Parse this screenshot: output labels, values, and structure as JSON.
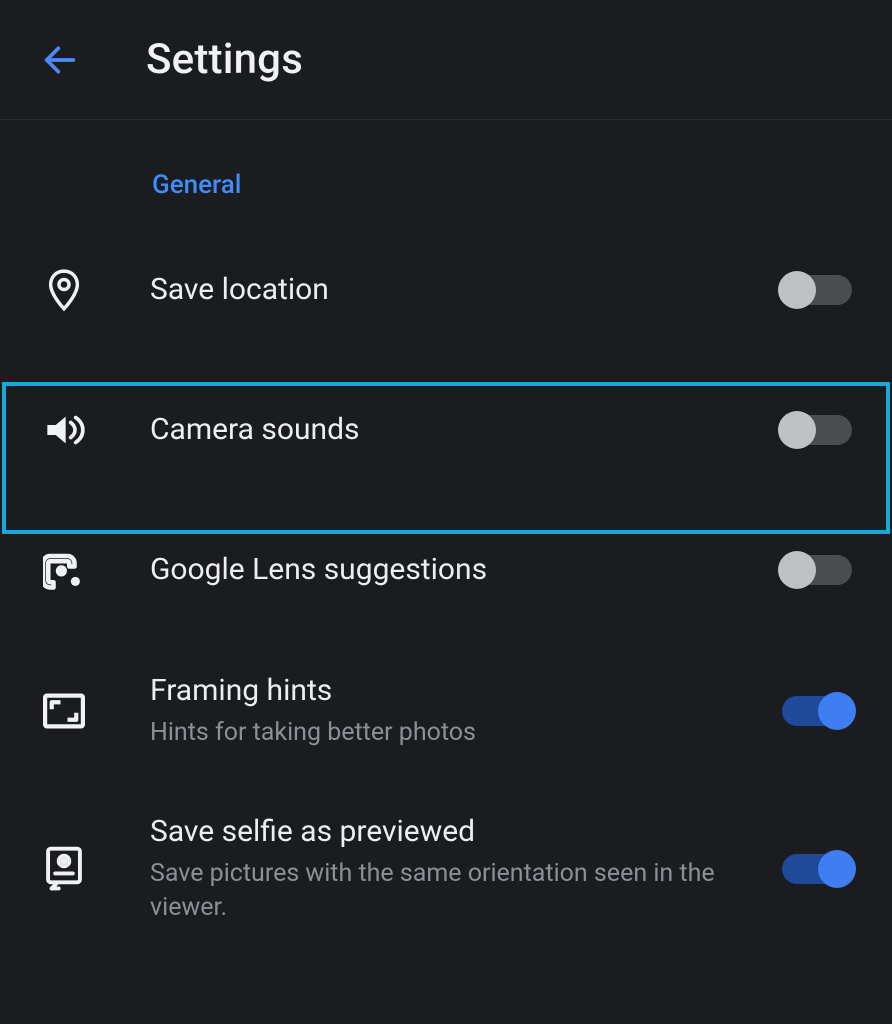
{
  "header": {
    "title": "Settings"
  },
  "section": {
    "label": "General"
  },
  "items": [
    {
      "key": "save-location",
      "title": "Save location",
      "subtitle": "",
      "toggle": "off"
    },
    {
      "key": "camera-sounds",
      "title": "Camera sounds",
      "subtitle": "",
      "toggle": "off"
    },
    {
      "key": "google-lens",
      "title": "Google Lens suggestions",
      "subtitle": "",
      "toggle": "off"
    },
    {
      "key": "framing-hints",
      "title": "Framing hints",
      "subtitle": "Hints for taking better photos",
      "toggle": "on"
    },
    {
      "key": "save-selfie",
      "title": "Save selfie as previewed",
      "subtitle": "Save pictures with the same orientation seen in the viewer.",
      "toggle": "on"
    }
  ]
}
